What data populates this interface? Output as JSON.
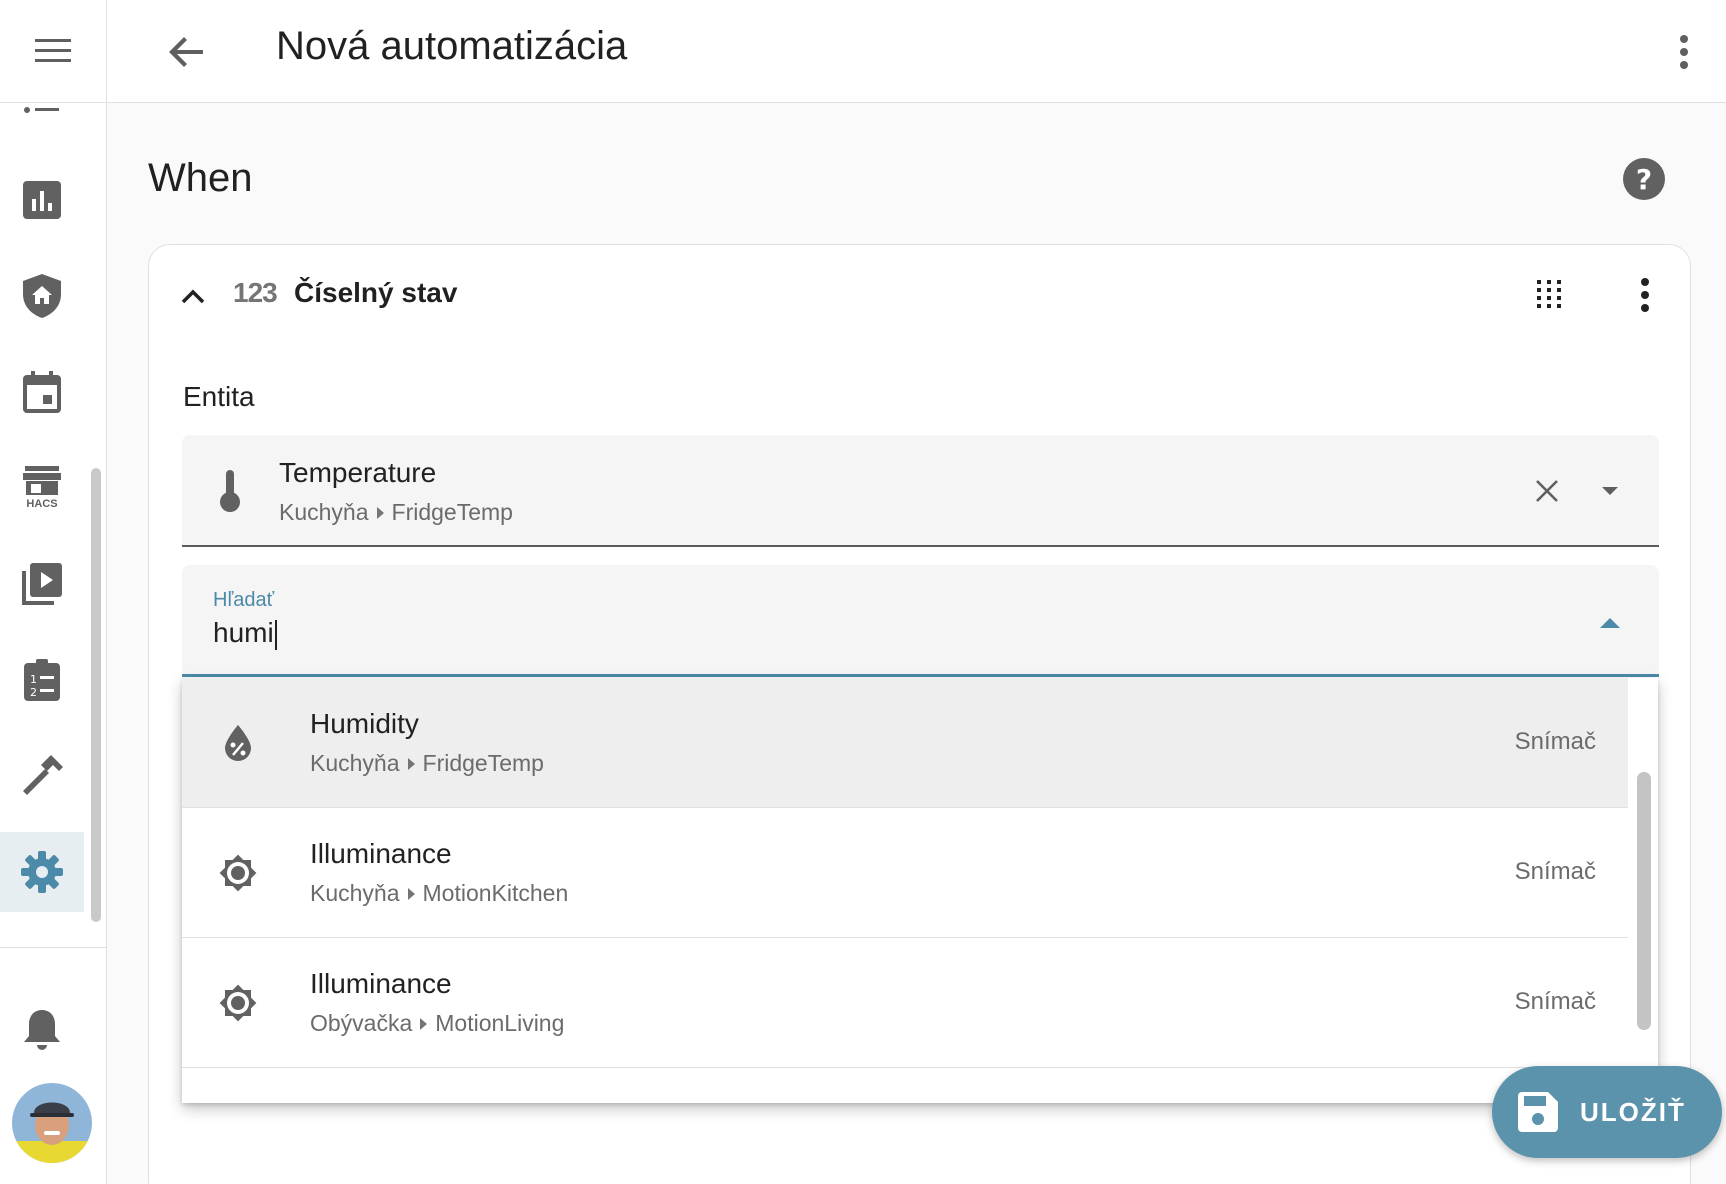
{
  "header": {
    "title": "Nová automatizácia",
    "menu_icon": "hamburger-menu-icon",
    "back_icon": "arrow-left-icon",
    "more_icon": "dots-vertical-icon"
  },
  "sidebar": {
    "items": [
      {
        "icon": "list-icon"
      },
      {
        "icon": "chart-bar-icon"
      },
      {
        "icon": "shield-home-icon"
      },
      {
        "icon": "calendar-icon"
      },
      {
        "icon": "hacs-store-icon",
        "label": "HACS"
      },
      {
        "icon": "play-box-multiple-icon"
      },
      {
        "icon": "clipboard-list-icon"
      },
      {
        "icon": "hammer-icon"
      },
      {
        "icon": "cog-icon",
        "active": true
      }
    ],
    "notifications_icon": "bell-icon",
    "avatar": "user-avatar"
  },
  "section": {
    "title": "When",
    "help_icon": "help-circle-icon"
  },
  "trigger_card": {
    "type_icon_text": "123",
    "title": "Číselný stav",
    "entity_label": "Entita",
    "selected_entity": {
      "name": "Temperature",
      "area": "Kuchyňa",
      "device": "FridgeTemp",
      "icon": "thermometer-icon"
    },
    "search": {
      "label": "Hľadať",
      "value": "humi"
    },
    "results": [
      {
        "name": "Humidity",
        "area": "Kuchyňa",
        "device": "FridgeTemp",
        "type": "Snímač",
        "icon": "water-percent-icon",
        "highlighted": true
      },
      {
        "name": "Illuminance",
        "area": "Kuchyňa",
        "device": "MotionKitchen",
        "type": "Snímač",
        "icon": "brightness-icon"
      },
      {
        "name": "Illuminance",
        "area": "Obývačka",
        "device": "MotionLiving",
        "type": "Snímač",
        "icon": "brightness-icon"
      }
    ]
  },
  "save_button": {
    "label": "ULOŽIŤ",
    "icon": "content-save-icon"
  },
  "colors": {
    "accent": "#4b8aa8",
    "save_bg": "#5b93ad",
    "active_bg": "#e7eef2"
  }
}
